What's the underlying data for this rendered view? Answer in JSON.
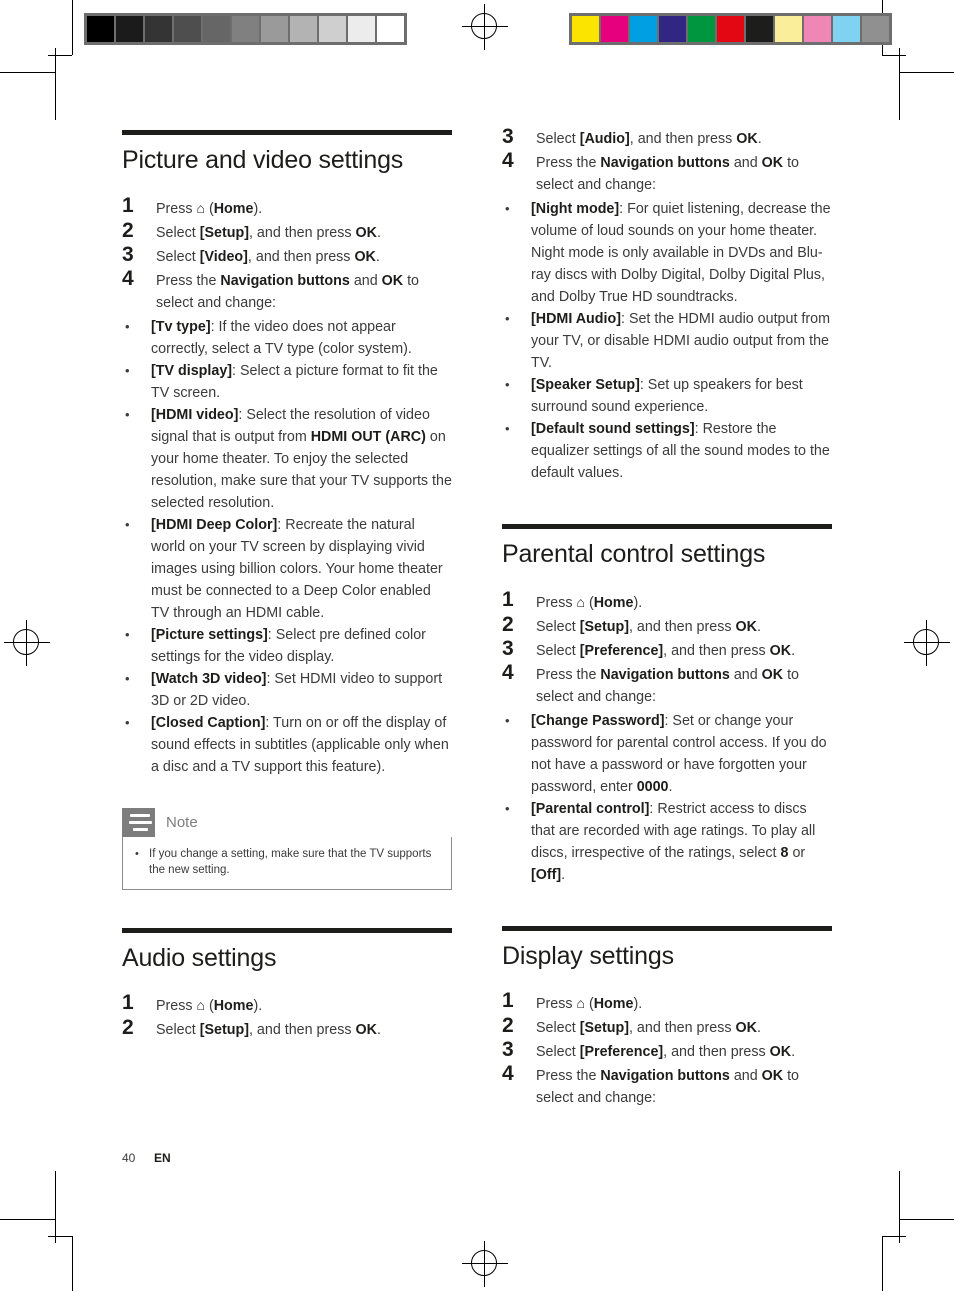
{
  "page": {
    "folio_number": "40",
    "folio_lang": "EN"
  },
  "calibration": {
    "grayscale_label": "grayscale-calibration-strip",
    "grayscale_patches": [
      "#000000",
      "#1b1b1b",
      "#343434",
      "#4e4e4e",
      "#666666",
      "#808080",
      "#9a9a9a",
      "#b3b3b3",
      "#cfcfcf",
      "#ececec",
      "#ffffff"
    ],
    "color_label": "color-calibration-strip",
    "color_patches": [
      "#fbe500",
      "#e6007e",
      "#009fe3",
      "#312783",
      "#009640",
      "#e30613",
      "#1d1d1b",
      "#fbee9a",
      "#ef86b6",
      "#7fd2f0",
      "#909090"
    ]
  },
  "left_column": {
    "sections": [
      {
        "title": "Picture and video settings",
        "steps": [
          {
            "num": "1",
            "html": "Press <span class=\"hm\">&#8962;</span> (<b>Home</b>)."
          },
          {
            "num": "2",
            "html": "Select <b>[Setup]</b>, and then press <b>OK</b>."
          },
          {
            "num": "3",
            "html": "Select <b>[Video]</b>, and then press <b>OK</b>."
          },
          {
            "num": "4",
            "html": "Press the <b>Navigation buttons</b> and <b>OK</b> to select and change:"
          }
        ],
        "bullets": [
          "<b>[Tv type]</b>: If the video does not appear correctly, select a TV type (color system).",
          "<b>[TV display]</b>: Select a picture format to fit the TV screen.",
          "<b>[HDMI video]</b>: Select the resolution of video signal that is output from <b>HDMI OUT (ARC)</b> on your home theater. To enjoy the selected resolution, make sure that your TV supports the selected resolution.",
          "<b>[HDMI Deep Color]</b>: Recreate the natural world on your TV screen by displaying vivid images using billion colors. Your home theater must be connected to a Deep Color enabled TV through an HDMI cable.",
          "<b>[Picture settings]</b>: Select pre defined color settings for the video display.",
          "<b>[Watch 3D video]</b>: Set HDMI video to support 3D or 2D video.",
          "<b>[Closed Caption]</b>: Turn on or off the display of sound effects in subtitles (applicable only when a disc and a TV support this feature)."
        ]
      },
      {
        "title": "Audio settings",
        "steps": [
          {
            "num": "1",
            "html": "Press <span class=\"hm\">&#8962;</span> (<b>Home</b>)."
          },
          {
            "num": "2",
            "html": "Select <b>[Setup]</b>, and then press <b>OK</b>."
          }
        ],
        "bullets": []
      }
    ],
    "note": {
      "label": "Note",
      "items": [
        "If you change a setting, make sure that the TV supports the new setting."
      ]
    }
  },
  "right_column": {
    "continued_steps": [
      {
        "num": "3",
        "html": "Select <b>[Audio]</b>, and then press <b>OK</b>."
      },
      {
        "num": "4",
        "html": "Press the <b>Navigation buttons</b> and <b>OK</b> to select and change:"
      }
    ],
    "continued_bullets": [
      "<b>[Night mode]</b>: For quiet listening, decrease the volume of loud sounds on your home theater. Night mode is only available in DVDs and Blu-ray discs with Dolby Digital, Dolby Digital Plus, and Dolby True HD soundtracks.",
      "<b>[HDMI Audio]</b>: Set the HDMI audio output from your TV, or disable HDMI audio output from the TV.",
      "<b>[Speaker Setup]</b>: Set up speakers for best surround sound experience.",
      "<b>[Default sound settings]</b>: Restore the equalizer settings of all the sound modes to the default values."
    ],
    "sections": [
      {
        "title": "Parental control settings",
        "steps": [
          {
            "num": "1",
            "html": "Press <span class=\"hm\">&#8962;</span> (<b>Home</b>)."
          },
          {
            "num": "2",
            "html": "Select <b>[Setup]</b>, and then press <b>OK</b>."
          },
          {
            "num": "3",
            "html": "Select <b>[Preference]</b>, and then press <b>OK</b>."
          },
          {
            "num": "4",
            "html": "Press the <b>Navigation buttons</b> and <b>OK</b> to select and change:"
          }
        ],
        "bullets": [
          "<b>[Change Password]</b>: Set or change your password for parental control access. If you do not have a password or have forgotten your password, enter <b>0000</b>.",
          "<b>[Parental control]</b>: Restrict access to discs that are recorded with age ratings. To play all discs, irrespective of the ratings, select <b>8</b> or <b>[Off]</b>."
        ]
      },
      {
        "title": "Display settings",
        "steps": [
          {
            "num": "1",
            "html": "Press <span class=\"hm\">&#8962;</span> (<b>Home</b>)."
          },
          {
            "num": "2",
            "html": "Select <b>[Setup]</b>, and then press <b>OK</b>."
          },
          {
            "num": "3",
            "html": "Select <b>[Preference]</b>, and then press <b>OK</b>."
          },
          {
            "num": "4",
            "html": "Press the <b>Navigation buttons</b> and <b>OK</b> to select and change:"
          }
        ],
        "bullets": []
      }
    ]
  }
}
